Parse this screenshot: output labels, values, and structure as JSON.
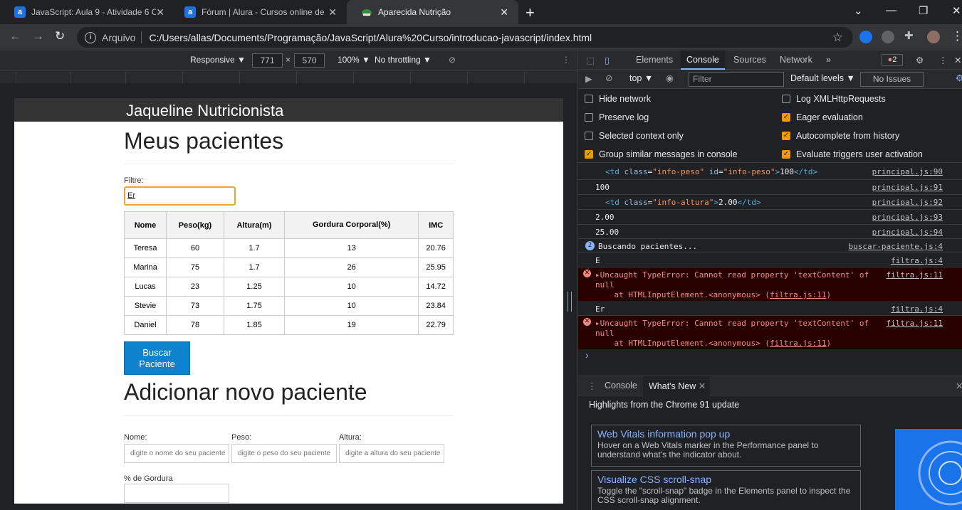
{
  "browser": {
    "tabs": [
      {
        "title": "JavaScript: Aula 9 - Atividade 6 C",
        "favicon": "a",
        "favcolor": "#1a73e8"
      },
      {
        "title": "Fórum | Alura - Cursos online de",
        "favicon": "a",
        "favcolor": "#1a73e8"
      },
      {
        "title": "Aparecida Nutrição",
        "favicon": "leaf",
        "favcolor": "#3c8b3a"
      }
    ],
    "scheme": "Arquivo",
    "url": "C:/Users/allas/Documents/Programação/JavaScript/Alura%20Curso/introducao-javascript/index.html"
  },
  "device_toolbar": {
    "mode": "Responsive ▼",
    "width": "771",
    "height": "570",
    "zoom": "100% ▼",
    "throttling": "No throttling ▼"
  },
  "page": {
    "header": "Jaqueline Nutricionista",
    "title": "Meus pacientes",
    "filter_label": "Filtre:",
    "filter_value": "Er",
    "table": {
      "headers": [
        "Nome",
        "Peso(kg)",
        "Altura(m)",
        "Gordura Corporal(%)",
        "IMC"
      ],
      "rows": [
        [
          "Teresa",
          "60",
          "1.7",
          "13",
          "20.76"
        ],
        [
          "Marina",
          "75",
          "1.7",
          "26",
          "25.95"
        ],
        [
          "Lucas",
          "23",
          "1.25",
          "10",
          "14.72"
        ],
        [
          "Stevie",
          "73",
          "1.75",
          "10",
          "23.84"
        ],
        [
          "Daniel",
          "78",
          "1.85",
          "19",
          "22.79"
        ]
      ]
    },
    "buscar_button": "Buscar Paciente",
    "add_title": "Adicionar novo paciente",
    "form": {
      "nome_label": "Nome:",
      "nome_placeholder": "digite o nome do seu paciente",
      "peso_label": "Peso:",
      "peso_placeholder": "digite o peso do seu paciente",
      "altura_label": "Altura:",
      "altura_placeholder": "digite a altura do seu paciente",
      "gordura_label": "% de Gordura"
    }
  },
  "devtools": {
    "tabs": [
      "Elements",
      "Console",
      "Sources",
      "Network",
      "»"
    ],
    "active_tab": "Console",
    "error_count": "2",
    "context": "top ▼",
    "filter_placeholder": "Filter",
    "levels": "Default levels ▼",
    "issues": "No Issues",
    "settings": {
      "hide_network": "Hide network",
      "preserve_log": "Preserve log",
      "selected_context": "Selected context only",
      "group_similar": "Group similar messages in console",
      "log_xhr": "Log XMLHttpRequests",
      "eager_eval": "Eager evaluation",
      "autocomplete": "Autocomplete from history",
      "eval_triggers": "Evaluate triggers user activation"
    },
    "console": {
      "l1_src": "principal.js:90",
      "l1_open": "<td",
      "l1_a1": "class",
      "l1_v1": "\"info-peso\"",
      "l1_a2": "id",
      "l1_v2": "\"info-peso\"",
      "l1_text": "100",
      "l1_close": "</td>",
      "l2": "100",
      "l2_src": "principal.js:91",
      "l3_src": "principal.js:92",
      "l3_a1": "class",
      "l3_v1": "\"info-altura\"",
      "l3_text": "2.00",
      "l4": "2.00",
      "l4_src": "principal.js:93",
      "l5": "25.00",
      "l5_src": "principal.js:94",
      "l6_count": "2",
      "l6": "Buscando pacientes...",
      "l6_src": "buscar-paciente.js:4",
      "l7": "E",
      "l7_src": "filtra.js:4",
      "err1_line1": "▸Uncaught TypeError: Cannot read property 'textContent' of",
      "err1_line2": "null",
      "err1_line3": "    at HTMLInputElement.<anonymous> (",
      "err1_link": "filtra.js:11",
      "err1_end": ")",
      "err1_src": "filtra.js:11",
      "l8": "Er",
      "l8_src": "filtra.js:4",
      "err2_line1": "▸Uncaught TypeError: Cannot read property 'textContent' of",
      "err2_line2": "null",
      "err2_line3": "    at HTMLInputElement.<anonymous> (",
      "err2_link": "filtra.js:11",
      "err2_end": ")",
      "err2_src": "filtra.js:11"
    },
    "drawer": {
      "tab1": "Console",
      "tab2": "What's New",
      "headline": "Highlights from the Chrome 91 update",
      "card1_title": "Web Vitals information pop up",
      "card1_desc": "Hover on a Web Vitals marker in the Performance panel to understand what's the indicator about.",
      "card2_title": "Visualize CSS scroll-snap",
      "card2_desc": "Toggle the \"scroll-snap\" badge in the Elements panel to inspect the CSS scroll-snap alignment."
    }
  }
}
